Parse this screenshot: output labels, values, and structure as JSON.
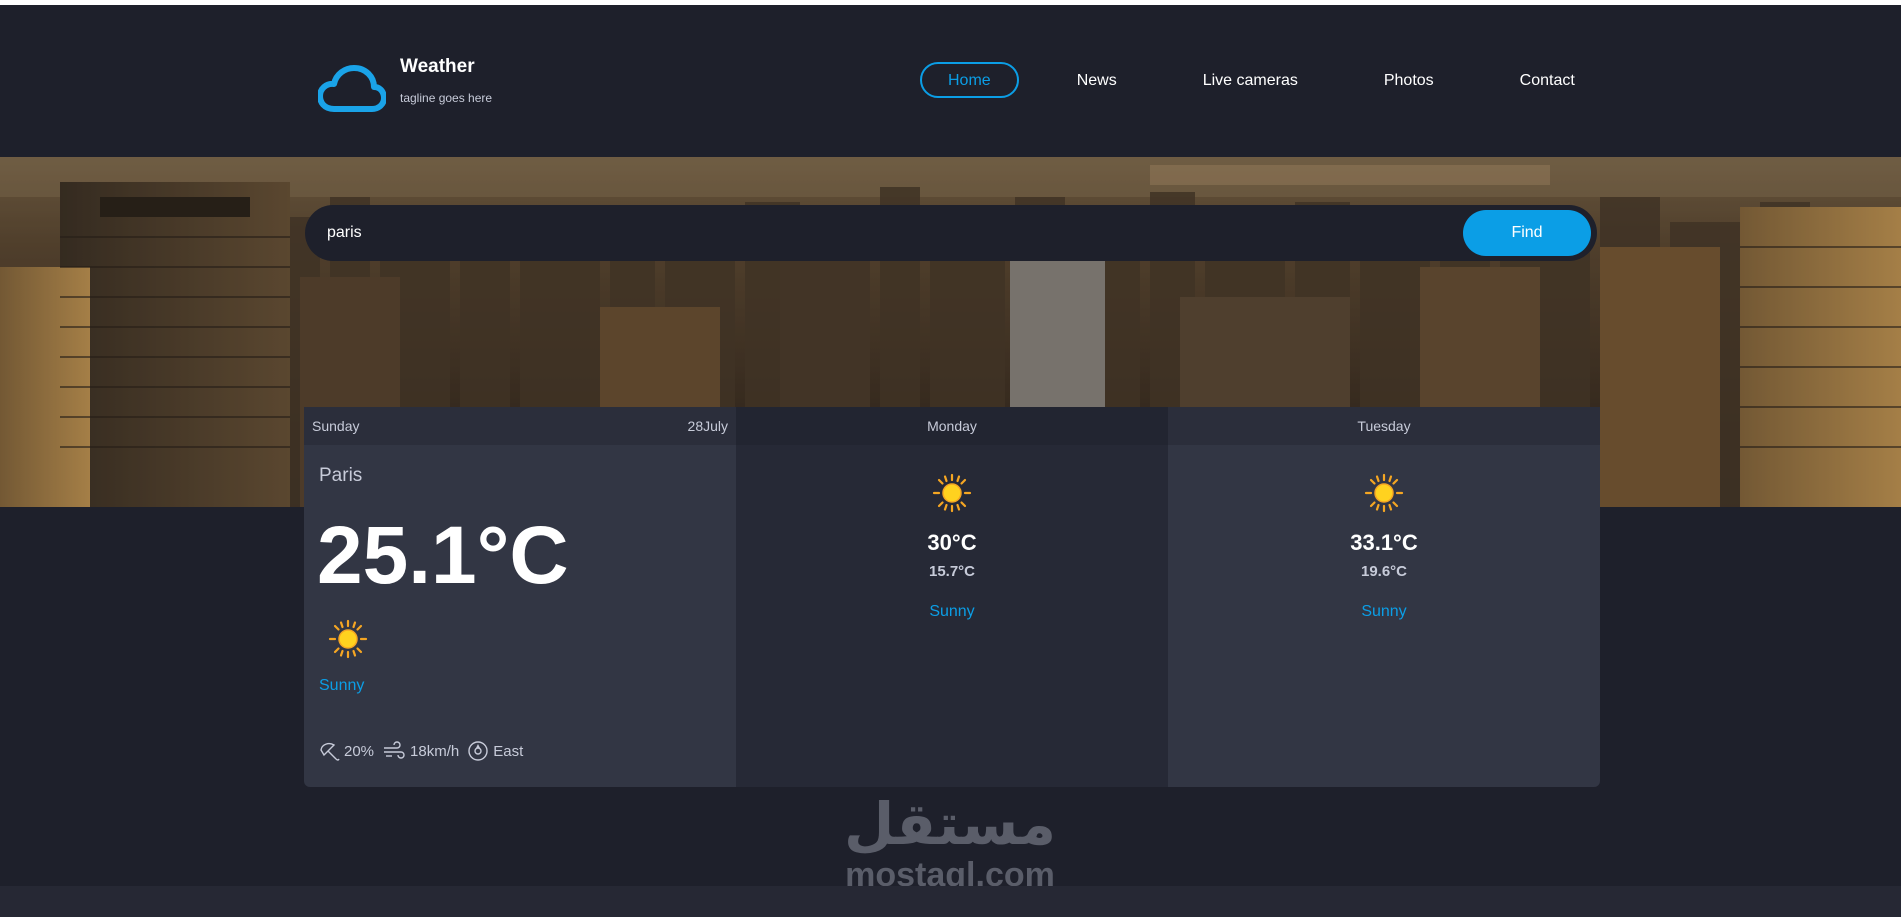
{
  "site": {
    "title": "Weather",
    "tagline": "tagline goes here"
  },
  "nav": [
    {
      "label": "Home",
      "active": true
    },
    {
      "label": "News",
      "active": false
    },
    {
      "label": "Live cameras",
      "active": false
    },
    {
      "label": "Photos",
      "active": false
    },
    {
      "label": "Contact",
      "active": false
    }
  ],
  "search": {
    "value": "paris",
    "button_label": "Find"
  },
  "today": {
    "day": "Sunday",
    "date": "28July",
    "city": "Paris",
    "temp": "25.1°C",
    "icon": "sun-icon",
    "condition": "Sunny",
    "humidity": "20%",
    "wind_speed": "18km/h",
    "wind_direction": "East"
  },
  "forecast": [
    {
      "day": "Monday",
      "max": "30°C",
      "min": "15.7°C",
      "condition": "Sunny",
      "icon": "sun-icon"
    },
    {
      "day": "Tuesday",
      "max": "33.1°C",
      "min": "19.6°C",
      "condition": "Sunny",
      "icon": "sun-icon"
    }
  ],
  "watermark": {
    "arabic": "مستقل",
    "latin": "mostaql.com"
  },
  "colors": {
    "accent": "#0b9ee6",
    "background": "#1e202b",
    "card": "#323644",
    "sun": "#ffd21f"
  }
}
